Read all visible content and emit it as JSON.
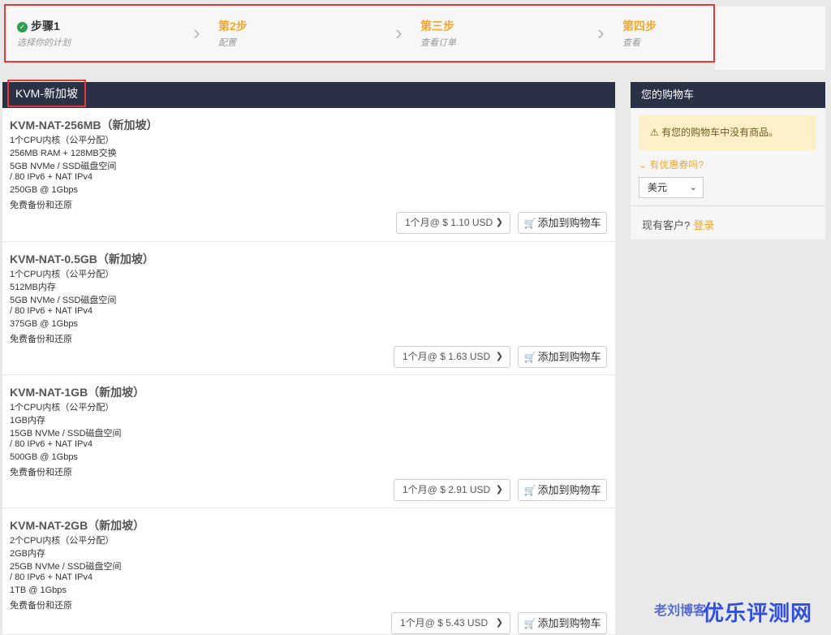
{
  "steps": [
    {
      "title": "步骤1",
      "subtitle": "选择你的计划",
      "state": "done"
    },
    {
      "title": "第2步",
      "subtitle": "配置",
      "state": "pending"
    },
    {
      "title": "第三步",
      "subtitle": "查看订单",
      "state": "pending"
    },
    {
      "title": "第四步",
      "subtitle": "查看",
      "state": "pending"
    }
  ],
  "category": {
    "title": "KVM-新加坡"
  },
  "add_to_cart_label": "添加到购物车",
  "products": [
    {
      "name": "KVM-NAT-256MB（新加坡）",
      "features": [
        "1个CPU内核（公平分配）",
        "256MB RAM + 128MB交换",
        "5GB NVMe / SSD磁盘空间",
        "/ 80 IPv6 + NAT IPv4",
        "250GB @ 1Gbps",
        "免费备份和还原"
      ],
      "cycle": "1个月@ $ 1.10 USD"
    },
    {
      "name": "KVM-NAT-0.5GB（新加坡）",
      "features": [
        "1个CPU内核（公平分配）",
        "512MB内存",
        "5GB NVMe / SSD磁盘空间",
        "/ 80 IPv6 + NAT IPv4",
        "375GB @ 1Gbps",
        "免费备份和还原"
      ],
      "cycle": "1个月@ $ 1.63 USD"
    },
    {
      "name": "KVM-NAT-1GB（新加坡）",
      "features": [
        "1个CPU内核（公平分配）",
        "1GB内存",
        "15GB NVMe / SSD磁盘空间",
        "/ 80 IPv6 + NAT IPv4",
        "500GB @ 1Gbps",
        "免费备份和还原"
      ],
      "cycle": "1个月@ $ 2.91 USD"
    },
    {
      "name": "KVM-NAT-2GB（新加坡）",
      "features": [
        "2个CPU内核（公平分配）",
        "2GB内存",
        "25GB NVMe / SSD磁盘空间",
        "/ 80 IPv6 + NAT IPv4",
        "1TB @ 1Gbps",
        "免费备份和还原"
      ],
      "cycle": "1个月@ $ 5.43 USD"
    }
  ],
  "cart": {
    "title": "您的购物车",
    "empty_message": "有您的购物车中没有商品。",
    "coupon_link": "有优惠券吗?",
    "currency": "美元",
    "existing_prompt": "现有客户?",
    "login_link": "登录"
  },
  "watermark": {
    "text1": "老刘博客",
    "text2": "优乐评测网"
  },
  "colors": {
    "accent": "#f5a623",
    "header_bg": "#2a3147",
    "highlight": "#e53935",
    "success": "#2e9e4f"
  }
}
